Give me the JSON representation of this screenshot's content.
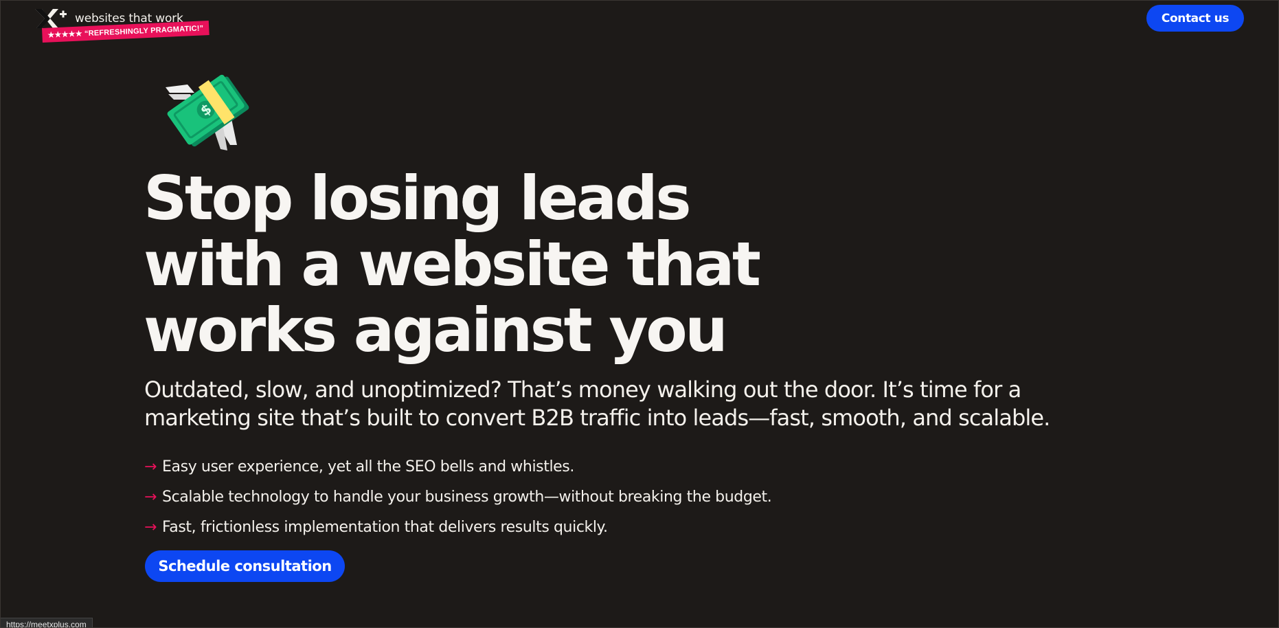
{
  "header": {
    "tagline": "websites that work",
    "badge": "★★★★★ “REFRESHINGLY PRAGMATIC!”",
    "contact_label": "Contact us",
    "logo_icon": "xplus-logo-icon"
  },
  "hero": {
    "illustration": "flying-money-icon",
    "headline": [
      "Stop losing leads",
      "with a website that",
      "works against you"
    ],
    "subheadline": [
      "Outdated, slow, and unoptimized? That’s money walking out the door. It’s time for a",
      "marketing site that’s built to convert B2B traffic into leads—fast, smooth, and scalable."
    ],
    "bullet_arrow": "→",
    "bullets": [
      "Easy user experience, yet all the SEO bells and whistles.",
      "Scalable technology to handle your business growth—without breaking the budget.",
      "Fast, frictionless implementation that delivers results quickly."
    ],
    "cta_label": "Schedule consultation"
  },
  "status_bar": {
    "url": "https://meetxplus.com"
  },
  "colors": {
    "background": "#1d1a18",
    "accent_blue": "#0d47f2",
    "accent_pink": "#e8115a",
    "text": "#f4f1ec"
  }
}
